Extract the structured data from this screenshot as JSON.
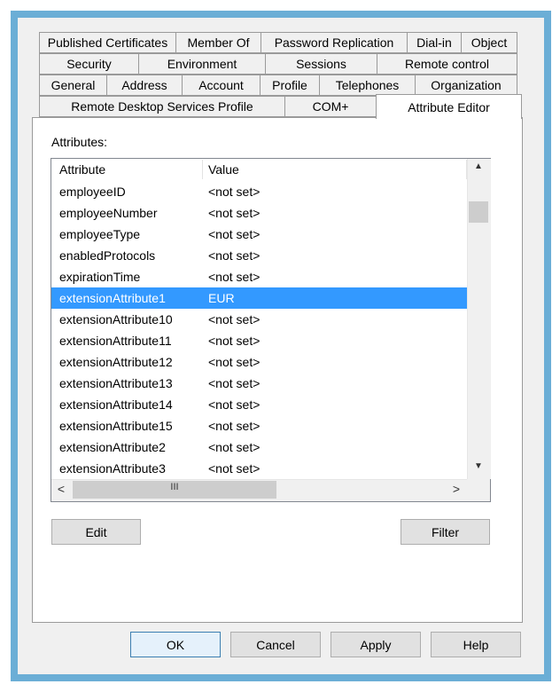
{
  "tabs": {
    "row1": [
      "Published Certificates",
      "Member Of",
      "Password Replication",
      "Dial-in",
      "Object"
    ],
    "row2": [
      "Security",
      "Environment",
      "Sessions",
      "Remote control"
    ],
    "row3": [
      "General",
      "Address",
      "Account",
      "Profile",
      "Telephones",
      "Organization"
    ],
    "row4": [
      "Remote Desktop Services Profile",
      "COM+",
      "Attribute Editor"
    ]
  },
  "attributes_label": "Attributes:",
  "list": {
    "columns": [
      "Attribute",
      "Value"
    ],
    "rows": [
      {
        "attribute": "employeeID",
        "value": "<not set>"
      },
      {
        "attribute": "employeeNumber",
        "value": "<not set>"
      },
      {
        "attribute": "employeeType",
        "value": "<not set>"
      },
      {
        "attribute": "enabledProtocols",
        "value": "<not set>"
      },
      {
        "attribute": "expirationTime",
        "value": "<not set>"
      },
      {
        "attribute": "extensionAttribute1",
        "value": "EUR"
      },
      {
        "attribute": "extensionAttribute10",
        "value": "<not set>"
      },
      {
        "attribute": "extensionAttribute11",
        "value": "<not set>"
      },
      {
        "attribute": "extensionAttribute12",
        "value": "<not set>"
      },
      {
        "attribute": "extensionAttribute13",
        "value": "<not set>"
      },
      {
        "attribute": "extensionAttribute14",
        "value": "<not set>"
      },
      {
        "attribute": "extensionAttribute15",
        "value": "<not set>"
      },
      {
        "attribute": "extensionAttribute2",
        "value": "<not set>"
      },
      {
        "attribute": "extensionAttribute3",
        "value": "<not set>"
      }
    ],
    "selected_index": 5,
    "scroll_icons": {
      "up": "▲",
      "down": "▼",
      "left": "<",
      "right": ">",
      "grip": "III"
    }
  },
  "buttons": {
    "edit": "Edit",
    "filter": "Filter",
    "ok": "OK",
    "cancel": "Cancel",
    "apply": "Apply",
    "help": "Help"
  },
  "colors": {
    "frame": "#6baed6",
    "selection": "#3399ff"
  }
}
